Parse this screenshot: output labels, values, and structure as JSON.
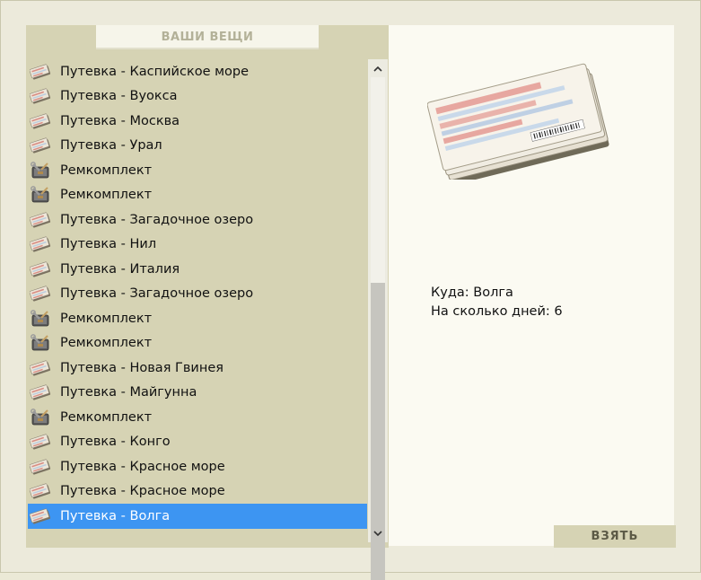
{
  "panel": {
    "title": "ВАШИ ВЕЩИ"
  },
  "items": [
    {
      "label": "Путевка - Каспийское море",
      "icon": "ticket-icon",
      "selected": false
    },
    {
      "label": "Путевка - Вуокса",
      "icon": "ticket-icon",
      "selected": false
    },
    {
      "label": "Путевка - Москва",
      "icon": "ticket-icon",
      "selected": false
    },
    {
      "label": "Путевка - Урал",
      "icon": "ticket-icon",
      "selected": false
    },
    {
      "label": "Ремкомплект",
      "icon": "repair-kit-icon",
      "selected": false
    },
    {
      "label": "Ремкомплект",
      "icon": "repair-kit-icon",
      "selected": false
    },
    {
      "label": "Путевка - Загадочное озеро",
      "icon": "ticket-icon",
      "selected": false
    },
    {
      "label": "Путевка - Нил",
      "icon": "ticket-icon",
      "selected": false
    },
    {
      "label": "Путевка - Италия",
      "icon": "ticket-icon",
      "selected": false
    },
    {
      "label": "Путевка - Загадочное озеро",
      "icon": "ticket-icon",
      "selected": false
    },
    {
      "label": "Ремкомплект",
      "icon": "repair-kit-icon",
      "selected": false
    },
    {
      "label": "Ремкомплект",
      "icon": "repair-kit-icon",
      "selected": false
    },
    {
      "label": "Путевка - Новая Гвинея",
      "icon": "ticket-icon",
      "selected": false
    },
    {
      "label": "Путевка - Майгунна",
      "icon": "ticket-icon",
      "selected": false
    },
    {
      "label": "Ремкомплект",
      "icon": "repair-kit-icon",
      "selected": false
    },
    {
      "label": "Путевка - Конго",
      "icon": "ticket-icon",
      "selected": false
    },
    {
      "label": "Путевка - Красное море",
      "icon": "ticket-icon",
      "selected": false
    },
    {
      "label": "Путевка - Красное море",
      "icon": "ticket-icon",
      "selected": false
    },
    {
      "label": "Путевка - Волга",
      "icon": "ticket-icon",
      "selected": true
    }
  ],
  "details": {
    "destination_label": "Куда:",
    "destination_value": "Волга",
    "days_label": "На сколько дней:",
    "days_value": "6"
  },
  "actions": {
    "take_label": "ВЗЯТЬ"
  },
  "colors": {
    "selection": "#3d95f2",
    "panel": "#d6d3b4",
    "background": "#ebe9d6"
  }
}
